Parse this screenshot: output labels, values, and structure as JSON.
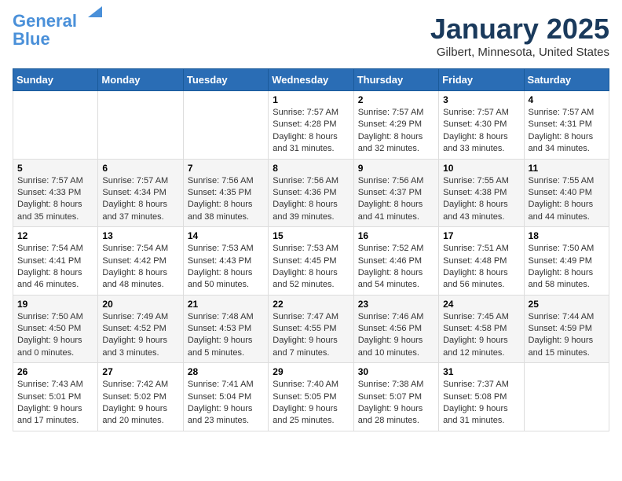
{
  "logo": {
    "line1": "General",
    "line2": "Blue"
  },
  "title": "January 2025",
  "location": "Gilbert, Minnesota, United States",
  "days_of_week": [
    "Sunday",
    "Monday",
    "Tuesday",
    "Wednesday",
    "Thursday",
    "Friday",
    "Saturday"
  ],
  "weeks": [
    [
      {
        "day": "",
        "info": ""
      },
      {
        "day": "",
        "info": ""
      },
      {
        "day": "",
        "info": ""
      },
      {
        "day": "1",
        "info": "Sunrise: 7:57 AM\nSunset: 4:28 PM\nDaylight: 8 hours\nand 31 minutes."
      },
      {
        "day": "2",
        "info": "Sunrise: 7:57 AM\nSunset: 4:29 PM\nDaylight: 8 hours\nand 32 minutes."
      },
      {
        "day": "3",
        "info": "Sunrise: 7:57 AM\nSunset: 4:30 PM\nDaylight: 8 hours\nand 33 minutes."
      },
      {
        "day": "4",
        "info": "Sunrise: 7:57 AM\nSunset: 4:31 PM\nDaylight: 8 hours\nand 34 minutes."
      }
    ],
    [
      {
        "day": "5",
        "info": "Sunrise: 7:57 AM\nSunset: 4:33 PM\nDaylight: 8 hours\nand 35 minutes."
      },
      {
        "day": "6",
        "info": "Sunrise: 7:57 AM\nSunset: 4:34 PM\nDaylight: 8 hours\nand 37 minutes."
      },
      {
        "day": "7",
        "info": "Sunrise: 7:56 AM\nSunset: 4:35 PM\nDaylight: 8 hours\nand 38 minutes."
      },
      {
        "day": "8",
        "info": "Sunrise: 7:56 AM\nSunset: 4:36 PM\nDaylight: 8 hours\nand 39 minutes."
      },
      {
        "day": "9",
        "info": "Sunrise: 7:56 AM\nSunset: 4:37 PM\nDaylight: 8 hours\nand 41 minutes."
      },
      {
        "day": "10",
        "info": "Sunrise: 7:55 AM\nSunset: 4:38 PM\nDaylight: 8 hours\nand 43 minutes."
      },
      {
        "day": "11",
        "info": "Sunrise: 7:55 AM\nSunset: 4:40 PM\nDaylight: 8 hours\nand 44 minutes."
      }
    ],
    [
      {
        "day": "12",
        "info": "Sunrise: 7:54 AM\nSunset: 4:41 PM\nDaylight: 8 hours\nand 46 minutes."
      },
      {
        "day": "13",
        "info": "Sunrise: 7:54 AM\nSunset: 4:42 PM\nDaylight: 8 hours\nand 48 minutes."
      },
      {
        "day": "14",
        "info": "Sunrise: 7:53 AM\nSunset: 4:43 PM\nDaylight: 8 hours\nand 50 minutes."
      },
      {
        "day": "15",
        "info": "Sunrise: 7:53 AM\nSunset: 4:45 PM\nDaylight: 8 hours\nand 52 minutes."
      },
      {
        "day": "16",
        "info": "Sunrise: 7:52 AM\nSunset: 4:46 PM\nDaylight: 8 hours\nand 54 minutes."
      },
      {
        "day": "17",
        "info": "Sunrise: 7:51 AM\nSunset: 4:48 PM\nDaylight: 8 hours\nand 56 minutes."
      },
      {
        "day": "18",
        "info": "Sunrise: 7:50 AM\nSunset: 4:49 PM\nDaylight: 8 hours\nand 58 minutes."
      }
    ],
    [
      {
        "day": "19",
        "info": "Sunrise: 7:50 AM\nSunset: 4:50 PM\nDaylight: 9 hours\nand 0 minutes."
      },
      {
        "day": "20",
        "info": "Sunrise: 7:49 AM\nSunset: 4:52 PM\nDaylight: 9 hours\nand 3 minutes."
      },
      {
        "day": "21",
        "info": "Sunrise: 7:48 AM\nSunset: 4:53 PM\nDaylight: 9 hours\nand 5 minutes."
      },
      {
        "day": "22",
        "info": "Sunrise: 7:47 AM\nSunset: 4:55 PM\nDaylight: 9 hours\nand 7 minutes."
      },
      {
        "day": "23",
        "info": "Sunrise: 7:46 AM\nSunset: 4:56 PM\nDaylight: 9 hours\nand 10 minutes."
      },
      {
        "day": "24",
        "info": "Sunrise: 7:45 AM\nSunset: 4:58 PM\nDaylight: 9 hours\nand 12 minutes."
      },
      {
        "day": "25",
        "info": "Sunrise: 7:44 AM\nSunset: 4:59 PM\nDaylight: 9 hours\nand 15 minutes."
      }
    ],
    [
      {
        "day": "26",
        "info": "Sunrise: 7:43 AM\nSunset: 5:01 PM\nDaylight: 9 hours\nand 17 minutes."
      },
      {
        "day": "27",
        "info": "Sunrise: 7:42 AM\nSunset: 5:02 PM\nDaylight: 9 hours\nand 20 minutes."
      },
      {
        "day": "28",
        "info": "Sunrise: 7:41 AM\nSunset: 5:04 PM\nDaylight: 9 hours\nand 23 minutes."
      },
      {
        "day": "29",
        "info": "Sunrise: 7:40 AM\nSunset: 5:05 PM\nDaylight: 9 hours\nand 25 minutes."
      },
      {
        "day": "30",
        "info": "Sunrise: 7:38 AM\nSunset: 5:07 PM\nDaylight: 9 hours\nand 28 minutes."
      },
      {
        "day": "31",
        "info": "Sunrise: 7:37 AM\nSunset: 5:08 PM\nDaylight: 9 hours\nand 31 minutes."
      },
      {
        "day": "",
        "info": ""
      }
    ]
  ]
}
